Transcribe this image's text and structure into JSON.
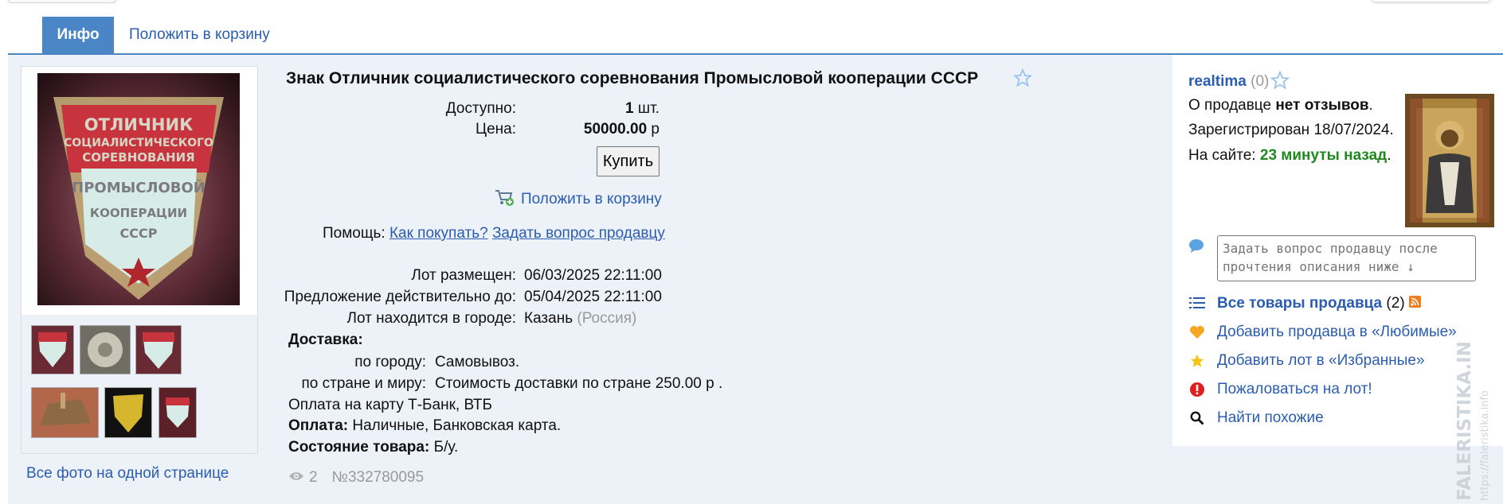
{
  "tabs": {
    "info": "Инфо",
    "cart": "Положить в корзину"
  },
  "lot": {
    "title": "Знак Отличник социалистического соревнования Промысловой кооперации СССР",
    "available_label": "Доступно:",
    "available_value": "1",
    "available_unit": "шт.",
    "price_label": "Цена:",
    "price_value": "50000.00",
    "price_currency": "р",
    "buy_button": "Купить",
    "add_to_cart": "Положить в корзину",
    "help_label": "Помощь:",
    "help_how_to_buy": "Как покупать?",
    "help_ask_seller": "Задать вопрос продавцу",
    "placed_label": "Лот размещен:",
    "placed_value": "06/03/2025 22:11:00",
    "valid_label": "Предложение действительно до:",
    "valid_value": "05/04/2025 22:11:00",
    "city_label": "Лот находится в городе:",
    "city_value": "Казань",
    "country_value": "(Россия)",
    "delivery_heading": "Доставка:",
    "delivery_city_label": "по городу:",
    "delivery_city_value": "Самовывоз.",
    "delivery_world_label": "по стране и миру:",
    "delivery_world_value": "Стоимость доставки по стране 250.00 р .",
    "card_payment_note": "Оплата на карту Т-Банк, ВТБ",
    "payment_label": "Оплата:",
    "payment_value": "Наличные, Банковская карта.",
    "condition_label": "Состояние товара:",
    "condition_value": "Б/у.",
    "views": "2",
    "lot_number": "№332780095"
  },
  "photos": {
    "badge_text_lines": [
      "ОТЛИЧНИК",
      "СОЦИАЛИСТИЧЕСКОГО",
      "СОРЕВНОВАНИЯ",
      "ПРОМЫСЛОВОЙ",
      "КООПЕРАЦИИ",
      "СССР"
    ],
    "all_photos_link": "Все фото на одной странице"
  },
  "seller": {
    "name": "realtima",
    "rating": "(0)",
    "feedback_prefix": "О продавце",
    "feedback_value": "нет отзывов",
    "feedback_suffix": ".",
    "registered": "Зарегистрирован 18/07/2024.",
    "online_prefix": "На сайте:",
    "online_value": "23 минуты назад",
    "online_suffix": ".",
    "question_placeholder": "Задать вопрос продавцу после прочтения описания ниже ↓",
    "all_items_label": "Все товары продавца",
    "all_items_count": "(2)",
    "add_favorite_seller": "Добавить продавца в «Любимые»",
    "add_favorite_lot": "Добавить лот в «Избранные»",
    "report_lot": "Пожаловаться на лот!",
    "find_similar": "Найти похожие"
  },
  "watermark": {
    "line1": "FALERISTIKA.INFO",
    "line2": "https://faleristika.info"
  },
  "colors": {
    "accent": "#4a86c6",
    "link": "#2a5db0",
    "online_green": "#1e8a1e",
    "rss": "#f07b1d",
    "heart": "#f5a623",
    "star": "#f5c518",
    "report": "#e02020"
  },
  "icons": [
    "star-outline-icon",
    "cart-add-icon",
    "eye-icon",
    "comment-icon",
    "list-icon",
    "rss-icon",
    "heart-icon",
    "star-icon",
    "exclamation-icon",
    "search-icon"
  ]
}
